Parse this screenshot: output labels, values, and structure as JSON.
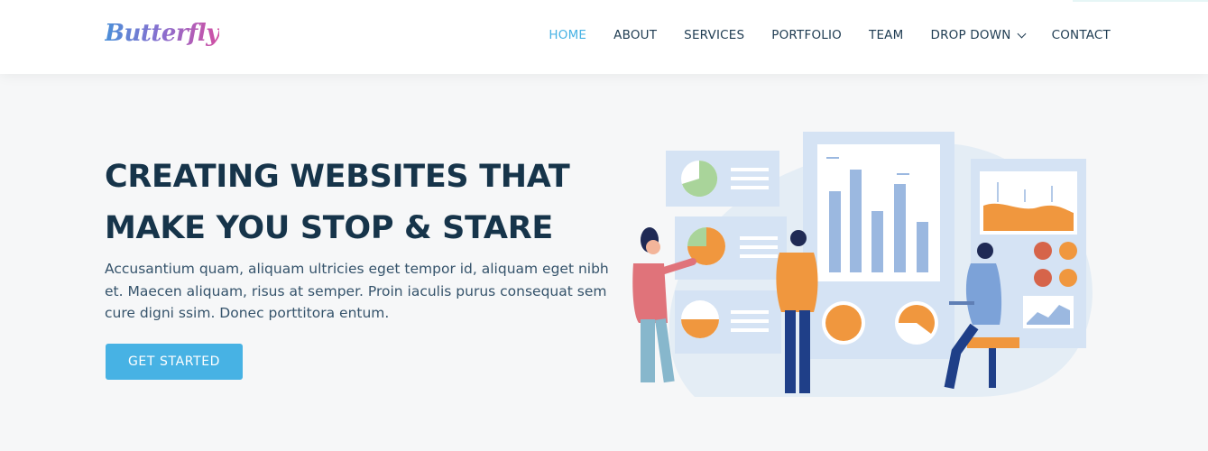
{
  "brand": {
    "logo_text": "Butterfly"
  },
  "nav": {
    "items": [
      {
        "label": "HOME",
        "active": true
      },
      {
        "label": "ABOUT"
      },
      {
        "label": "SERVICES"
      },
      {
        "label": "PORTFOLIO"
      },
      {
        "label": "TEAM"
      },
      {
        "label": "DROP DOWN",
        "icon": "chevron-down-icon"
      },
      {
        "label": "CONTACT"
      }
    ]
  },
  "hero": {
    "title_line1": "CREATING WEBSITES THAT",
    "title_line2": "MAKE YOU STOP & STARE",
    "description": "Accusantium quam, aliquam ultricies eget tempor id, aliquam eget nibh et. Maecen aliquam, risus at semper. Proin iaculis purus consequat sem cure digni ssim. Donec porttitora entum.",
    "cta_label": "GET STARTED"
  },
  "colors": {
    "accent": "#47b2e4",
    "heading": "#16344a",
    "nav_text": "#1f3c52",
    "background": "#f6f7f8",
    "illustration_orange": "#f0973e",
    "illustration_blue": "#9bb8e0"
  }
}
